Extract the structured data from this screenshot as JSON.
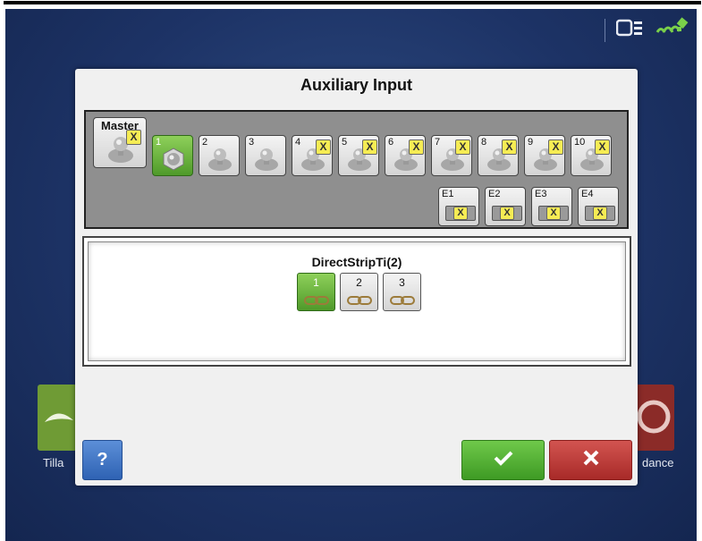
{
  "dialog": {
    "title": "Auxiliary Input",
    "master_label": "Master",
    "inputs": [
      {
        "label": "1",
        "status": "selected"
      },
      {
        "label": "2",
        "status": "available"
      },
      {
        "label": "3",
        "status": "available"
      },
      {
        "label": "4",
        "status": "unavailable"
      },
      {
        "label": "5",
        "status": "unavailable"
      },
      {
        "label": "6",
        "status": "unavailable"
      },
      {
        "label": "7",
        "status": "unavailable"
      },
      {
        "label": "8",
        "status": "unavailable"
      },
      {
        "label": "9",
        "status": "unavailable"
      },
      {
        "label": "10",
        "status": "unavailable"
      }
    ],
    "external_inputs": [
      "E1",
      "E2",
      "E3",
      "E4"
    ],
    "implement": {
      "name": "DirectStripTi(2)",
      "sections": [
        {
          "label": "1",
          "status": "selected"
        },
        {
          "label": "2",
          "status": "available"
        },
        {
          "label": "3",
          "status": "available"
        }
      ]
    },
    "help_label": "?"
  },
  "background": {
    "left_app_label": "Tilla",
    "right_app_label": "dance"
  },
  "colors": {
    "selected_green": "#5fae38",
    "unavailable_x": "#f6ec54",
    "help_blue": "#3a6fc0",
    "ok_green": "#4fae2e",
    "cancel_red": "#bb3835",
    "screen_blue": "#1d3366"
  },
  "icons": {
    "status_bar": [
      "display-connector-icon",
      "gps-satellite-icon"
    ],
    "input": "joystick-knob-icon",
    "unavailable": "x-mark-icon",
    "external": "connector-plug-icon",
    "section": "chain-link-icon",
    "ok": "checkmark-icon",
    "cancel": "close-icon"
  }
}
